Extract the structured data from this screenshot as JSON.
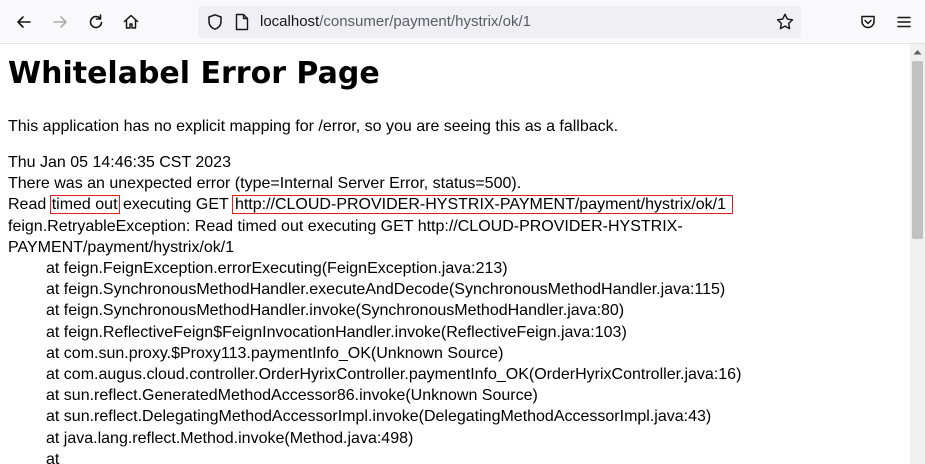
{
  "browser": {
    "url_host": "localhost",
    "url_path": "/consumer/payment/hystrix/ok/1",
    "icons": [
      "back-arrow-icon",
      "forward-arrow-icon",
      "reload-icon",
      "home-icon",
      "shield-icon",
      "page-icon",
      "star-icon",
      "pocket-icon",
      "menu-icon"
    ]
  },
  "page": {
    "title": "Whitelabel Error Page",
    "fallback_message": "This application has no explicit mapping for /error, so you are seeing this as a fallback.",
    "timestamp": "Thu Jan 05 14:46:35 CST 2023",
    "error_summary": "There was an unexpected error (type=Internal Server Error, status=500).",
    "read_prefix": "Read ",
    "read_timed_out": "timed out",
    "read_executing": " executing GET ",
    "read_url": "http://CLOUD-PROVIDER-HYSTRIX-PAYMENT/payment/hystrix/ok/1",
    "exception_line": "feign.RetryableException: Read timed out executing GET http://CLOUD-PROVIDER-HYSTRIX-PAYMENT/payment/hystrix/ok/1",
    "stack": [
      "at feign.FeignException.errorExecuting(FeignException.java:213)",
      "at feign.SynchronousMethodHandler.executeAndDecode(SynchronousMethodHandler.java:115)",
      "at feign.SynchronousMethodHandler.invoke(SynchronousMethodHandler.java:80)",
      "at feign.ReflectiveFeign$FeignInvocationHandler.invoke(ReflectiveFeign.java:103)",
      "at com.sun.proxy.$Proxy113.paymentInfo_OK(Unknown Source)",
      "at com.augus.cloud.controller.OrderHyrixController.paymentInfo_OK(OrderHyrixController.java:16)",
      "at sun.reflect.GeneratedMethodAccessor86.invoke(Unknown Source)",
      "at sun.reflect.DelegatingMethodAccessorImpl.invoke(DelegatingMethodAccessorImpl.java:43)",
      "at java.lang.reflect.Method.invoke(Method.java:498)",
      "at"
    ],
    "highlight_color": "#e0201f"
  }
}
